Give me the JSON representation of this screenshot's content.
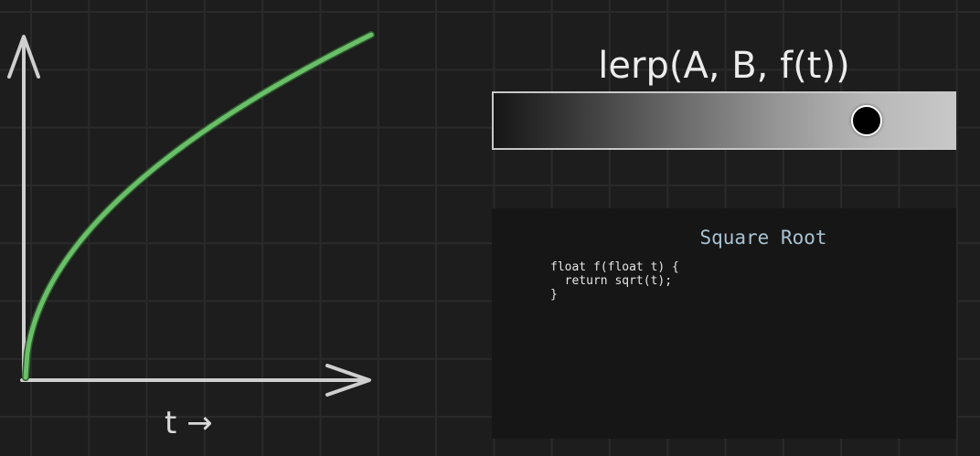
{
  "chart_data": {
    "type": "line",
    "function": "sqrt",
    "x": [
      0,
      0.05,
      0.1,
      0.2,
      0.3,
      0.4,
      0.5,
      0.6,
      0.7,
      0.8,
      0.9,
      1.0
    ],
    "y": [
      0,
      0.2236,
      0.3162,
      0.4472,
      0.5477,
      0.6325,
      0.7071,
      0.7746,
      0.8367,
      0.8944,
      0.9487,
      1.0
    ],
    "xlabel": "t →",
    "ylabel": "",
    "xlim": [
      0,
      1
    ],
    "ylim": [
      0,
      1
    ],
    "grid": true,
    "colors": {
      "curve": "#6abf69",
      "axes": "#cfcfcf"
    }
  },
  "graph": {
    "x_axis_label": "t →"
  },
  "lerp": {
    "title": "lerp(A, B, f(t))",
    "value": 0.81,
    "colors": {
      "start": "#161616",
      "end": "#c8c8c8",
      "marker": "#000000"
    }
  },
  "code": {
    "title": "Square Root",
    "lines": [
      "float f(float t) {",
      "  return sqrt(t);",
      "}"
    ]
  }
}
